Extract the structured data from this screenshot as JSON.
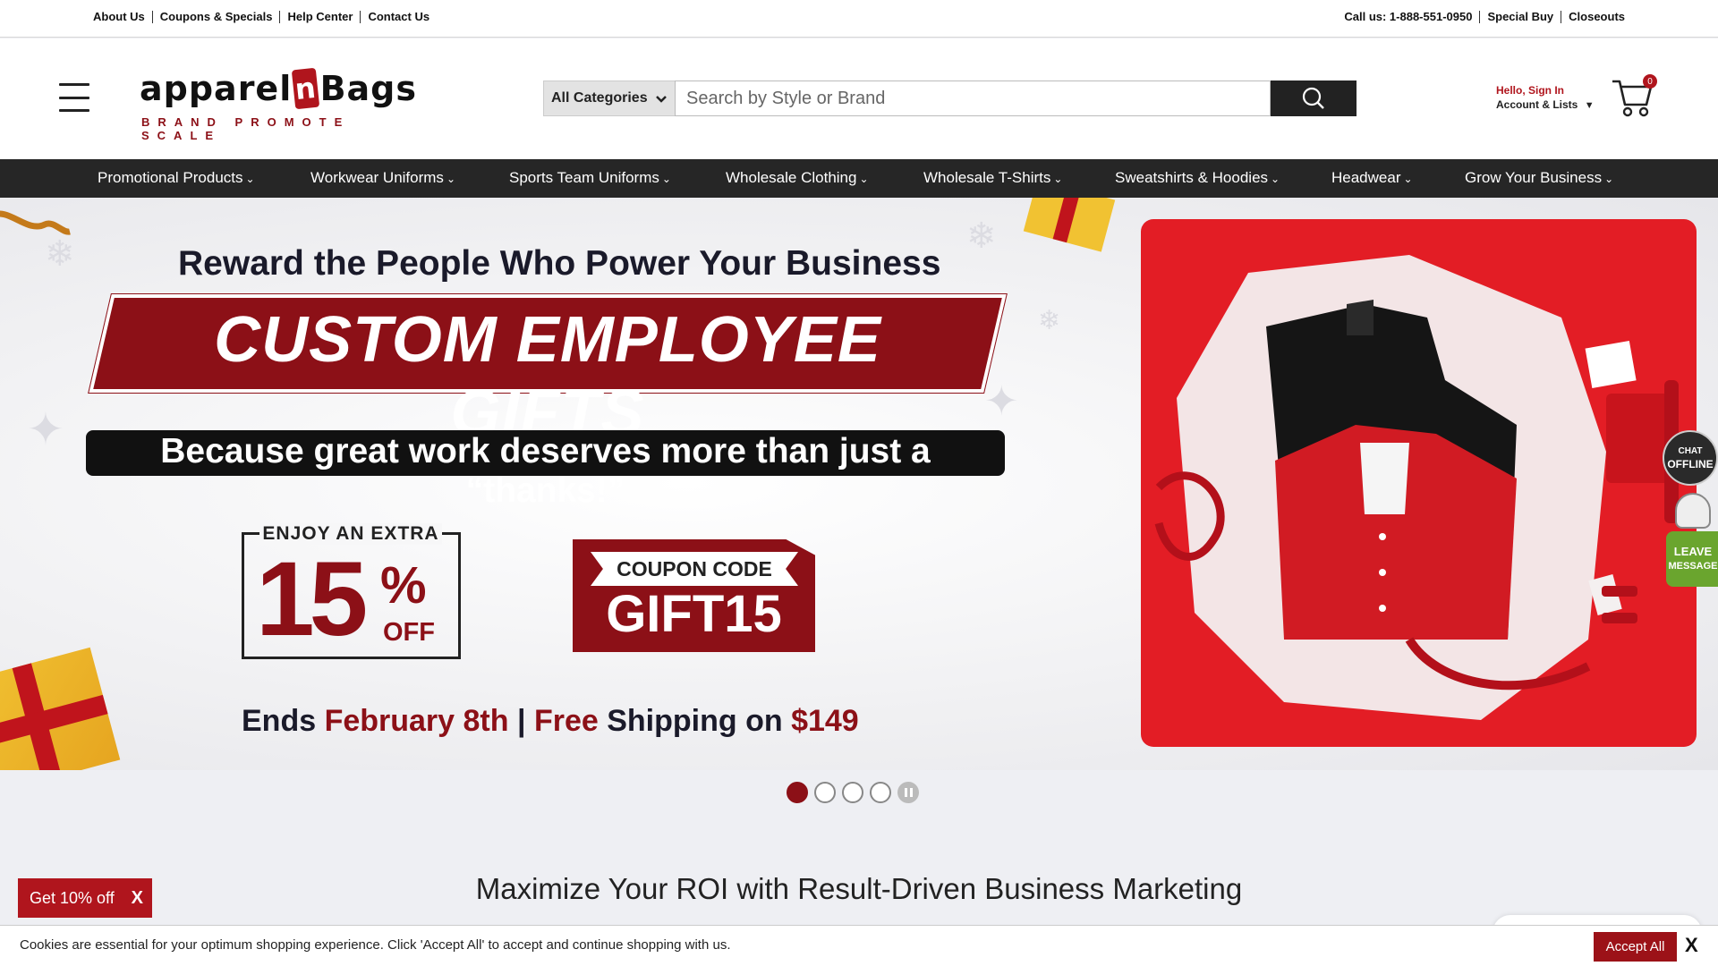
{
  "utility": {
    "left_links": [
      "About Us",
      "Coupons & Specials",
      "Help Center",
      "Contact Us"
    ],
    "call": "Call us: 1-888-551-0950",
    "special_buy": "Special Buy",
    "closeouts": "Closeouts"
  },
  "header": {
    "logo_word_pre": "apparel",
    "logo_n": "n",
    "logo_word_post": "Bags",
    "logo_tagline": "BRAND PROMOTE SCALE",
    "hamburger_icon": "menu-icon"
  },
  "search": {
    "category": "All Categories",
    "placeholder": "Search by Style or Brand",
    "value": "",
    "button_icon": "search-icon"
  },
  "account": {
    "hello": "Hello, Sign In",
    "lists": "Account & Lists"
  },
  "cart": {
    "count": "0",
    "icon": "cart-icon"
  },
  "nav": {
    "items": [
      "Promotional Products",
      "Workwear Uniforms",
      "Sports Team Uniforms",
      "Wholesale Clothing",
      "Wholesale T-Shirts",
      "Sweatshirts & Hoodies",
      "Headwear",
      "Grow Your Business"
    ]
  },
  "hero": {
    "kicker": "Reward the People Who Power Your Business",
    "title": "CUSTOM EMPLOYEE GIFTS",
    "subtitle": "Because great work deserves more than just a “thanks!”",
    "offer_top": "ENJOY AN EXTRA",
    "offer_number": "15",
    "offer_percent": "%",
    "offer_off": "OFF",
    "coupon_label": "COUPON CODE",
    "coupon_code": "GIFT15",
    "ends_1": "Ends ",
    "ends_2": "February 8th",
    "ends_3": " | ",
    "ends_4": "Free",
    "ends_5": " Shipping on ",
    "ends_6": "$149"
  },
  "carousel": {
    "slides": 4,
    "active": 1
  },
  "section": {
    "title": "Maximize Your ROI with Result-Driven Business Marketing"
  },
  "chat": {
    "line1": "CHAT",
    "line2": "OFFLINE",
    "leave1": "LEAVE",
    "leave2": "MESSAGE"
  },
  "promo": {
    "label": "Get 10% off",
    "close": "X"
  },
  "cookie": {
    "text": "Cookies are essential for your optimum shopping experience. Click 'Accept All' to accept and continue shopping with us.",
    "accept": "Accept All",
    "close": "X"
  },
  "colors": {
    "brand_red": "#8c1017",
    "nav_bg": "#262626",
    "hero_panel": "#e31d25",
    "chat_green": "#6aa52e"
  }
}
